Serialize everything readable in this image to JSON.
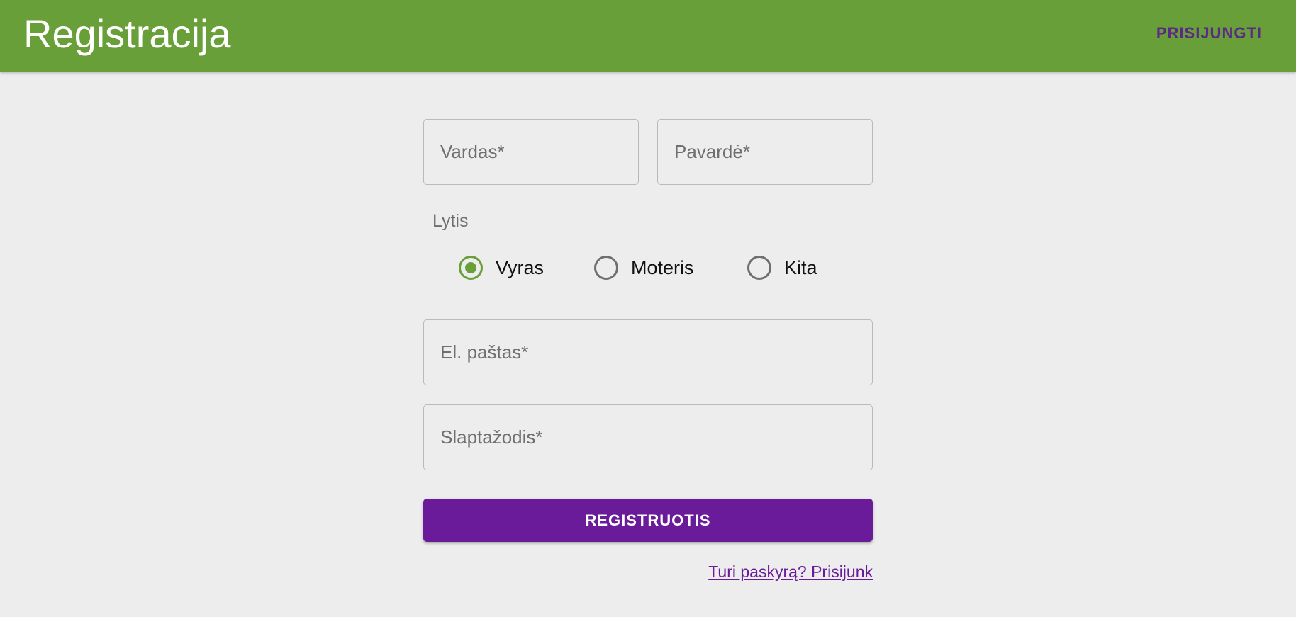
{
  "header": {
    "title": "Registracija",
    "login_action": "PRISIJUNGTI",
    "background_color": "#689f38"
  },
  "form": {
    "first_name": {
      "placeholder": "Vardas*",
      "value": ""
    },
    "last_name": {
      "placeholder": "Pavardė*",
      "value": ""
    },
    "gender": {
      "label": "Lytis",
      "options": [
        {
          "label": "Vyras",
          "checked": true
        },
        {
          "label": "Moteris",
          "checked": false
        },
        {
          "label": "Kita",
          "checked": false
        }
      ]
    },
    "email": {
      "placeholder": "El. paštas*",
      "value": ""
    },
    "password": {
      "placeholder": "Slaptažodis*",
      "value": ""
    },
    "submit_label": "REGISTRUOTIS",
    "login_link": "Turi paskyrą? Prisijunk"
  },
  "colors": {
    "accent": "#689f38",
    "primary_button": "#6a1b9a",
    "page_background": "#ededed"
  }
}
